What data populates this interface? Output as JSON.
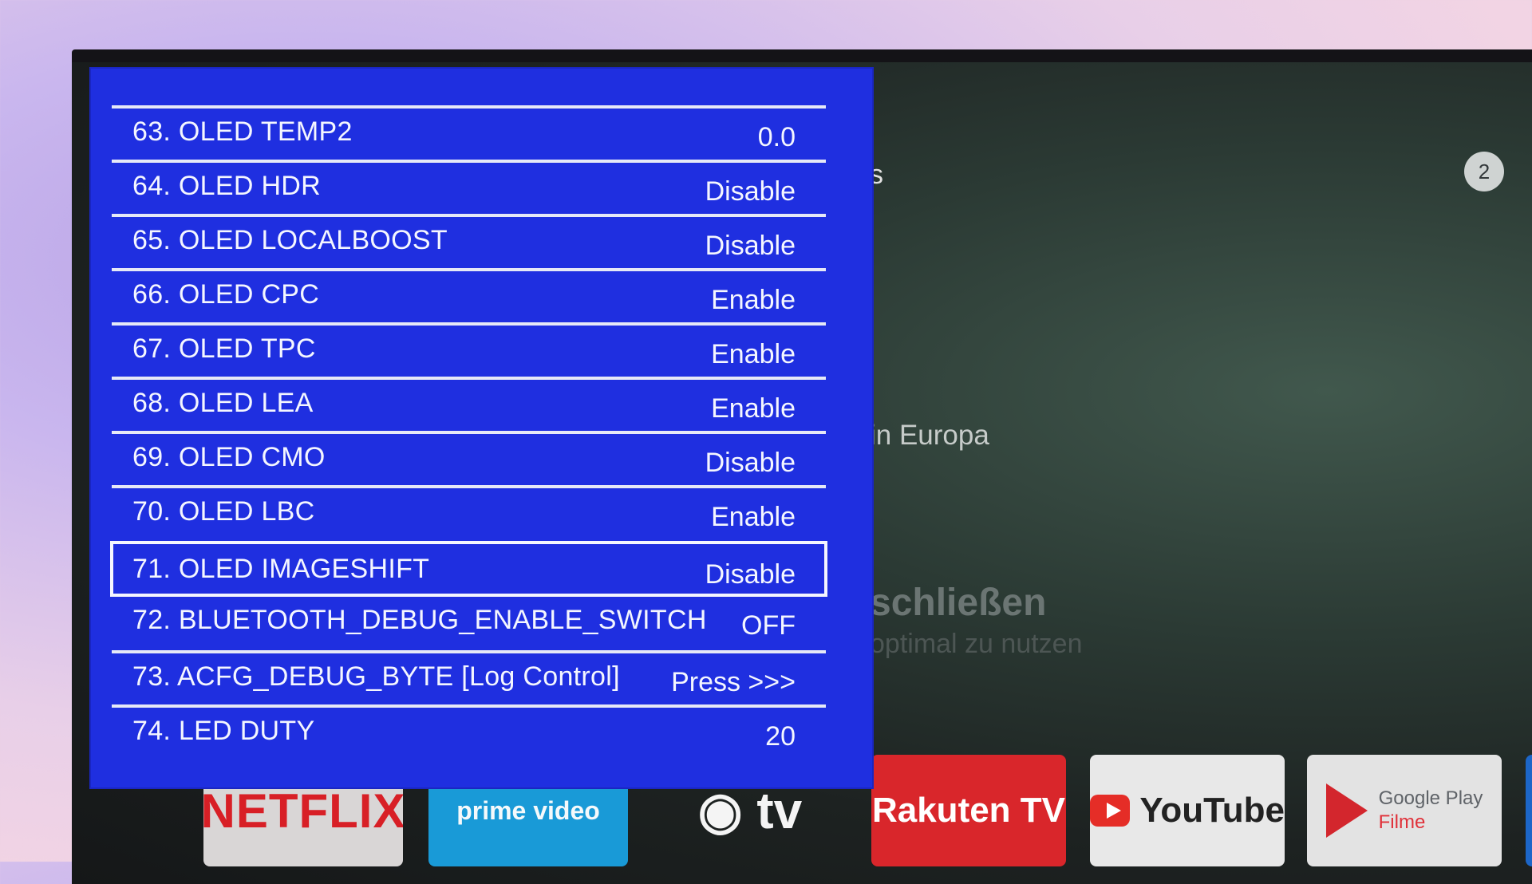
{
  "background": {
    "partial_texts": [
      "s",
      "in Europa",
      "schließen",
      "optimal zu nutzen"
    ],
    "badge": "2"
  },
  "apps": {
    "netflix": "NETFLIX",
    "prime": "prime video",
    "appletv": "tv",
    "rakuten": "Rakuten TV",
    "youtube": "YouTube",
    "gplay_line1": "Google Play",
    "gplay_line2": "Filme"
  },
  "menu": {
    "items": [
      {
        "label": "63. OLED TEMP2",
        "value": "0.0"
      },
      {
        "label": "64. OLED HDR",
        "value": "Disable"
      },
      {
        "label": "65. OLED LOCALBOOST",
        "value": "Disable"
      },
      {
        "label": "66. OLED CPC",
        "value": "Enable"
      },
      {
        "label": "67. OLED TPC",
        "value": "Enable"
      },
      {
        "label": "68. OLED LEA",
        "value": "Enable"
      },
      {
        "label": "69. OLED CMO",
        "value": "Disable"
      },
      {
        "label": "70. OLED LBC",
        "value": "Enable"
      },
      {
        "label": "71. OLED IMAGESHIFT",
        "value": "Disable"
      },
      {
        "label": "72. BLUETOOTH_DEBUG_ENABLE_SWITCH",
        "value": "OFF"
      },
      {
        "label": "73. ACFG_DEBUG_BYTE [Log Control]",
        "value": "Press >>>"
      },
      {
        "label": "74. LED DUTY",
        "value": "20"
      }
    ],
    "selected_index": 8,
    "colors": {
      "panel": "#1f2fe0",
      "text": "#f4f6ff"
    }
  }
}
